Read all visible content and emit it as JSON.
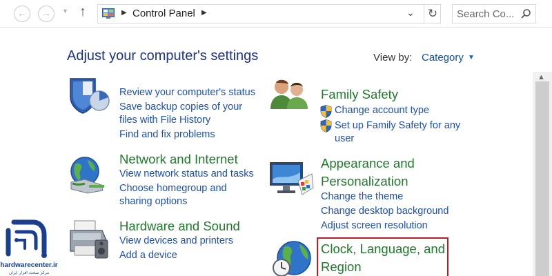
{
  "nav": {
    "back_glyph": "←",
    "forward_glyph": "→",
    "recent_glyph": "▼",
    "up_glyph": "↑"
  },
  "address": {
    "breadcrumb_sep": "▶",
    "location": "Control Panel",
    "dropdown_glyph": "⌄",
    "refresh_glyph": "↻"
  },
  "search": {
    "placeholder": "Search Co..."
  },
  "header": {
    "title": "Adjust your computer's settings",
    "view_by_label": "View by:",
    "view_by_value": "Category",
    "view_by_arrow": "▼"
  },
  "categories": {
    "system_security": {
      "links": [
        "Review your computer's status",
        "Save backup copies of your",
        "files with File History",
        "Find and fix problems"
      ]
    },
    "network": {
      "title": "Network and Internet",
      "links": [
        "View network status and tasks",
        "Choose homegroup and",
        "sharing options"
      ]
    },
    "hardware": {
      "title": "Hardware and Sound",
      "links": [
        "View devices and printers",
        "Add a device"
      ]
    },
    "family": {
      "title": "Family Safety",
      "links": [
        "Change account type",
        "Set up Family Safety for any",
        "user"
      ]
    },
    "appearance": {
      "title_line1": "Appearance and",
      "title_line2": "Personalization",
      "links": [
        "Change the theme",
        "Change desktop background",
        "Adjust screen resolution"
      ]
    },
    "clock": {
      "title_line1": "Clock, Language, and",
      "title_line2": "Region"
    }
  },
  "scrollbar": {
    "up_glyph": "▲"
  },
  "watermark": {
    "site": "hardwarecenter.ir",
    "tagline": "مرکز سخت افزار ایران"
  },
  "colors": {
    "title_blue": "#1e3287",
    "category_green": "#1f7a2b",
    "link_blue": "#1d4fb6",
    "highlight_red": "#b51f1f",
    "logo_blue": "#1a3f8f"
  }
}
